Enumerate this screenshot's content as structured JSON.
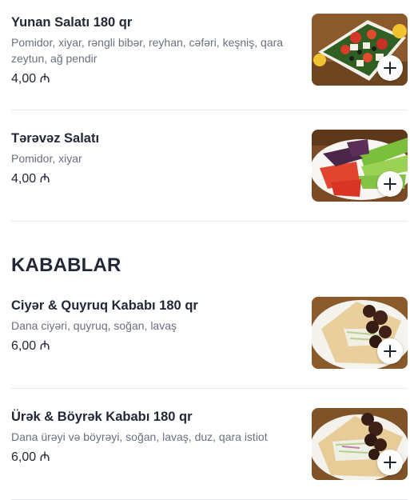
{
  "currency_symbol": "₼",
  "sections": [
    {
      "items": [
        {
          "title": "Yunan Salatı 180 qr",
          "description": "Pomidor, xiyar, rəngli bibər, reyhan, cəfəri, keşniş, qara zeytun, ağ pendir",
          "price": "4,00 ₼",
          "photo": "greek-salad-photo",
          "add_icon": "plus-icon"
        },
        {
          "title": "Tərəvəz Salatı",
          "description": "Pomidor, xiyar",
          "price": "4,00 ₼",
          "photo": "vegetable-salad-photo",
          "add_icon": "plus-icon"
        }
      ]
    },
    {
      "title": "KABABLAR",
      "items": [
        {
          "title": "Ciyər & Quyruq Kababı 180 qr",
          "description": "Dana ciyəri, quyruq, soğan, lavaş",
          "price": "6,00 ₼",
          "photo": "liver-kebab-photo",
          "add_icon": "plus-icon"
        },
        {
          "title": "Ürək & Böyrək Kababı 180 qr",
          "description": "Dana ürəyi və böyrəyi, soğan, lavaş, duz, qara istiot",
          "price": "6,00 ₼",
          "photo": "heart-kidney-kebab-photo",
          "add_icon": "plus-icon"
        }
      ]
    }
  ],
  "colors": {
    "text": "#232836",
    "muted": "#6b7080",
    "divider": "#e7e8ec"
  }
}
